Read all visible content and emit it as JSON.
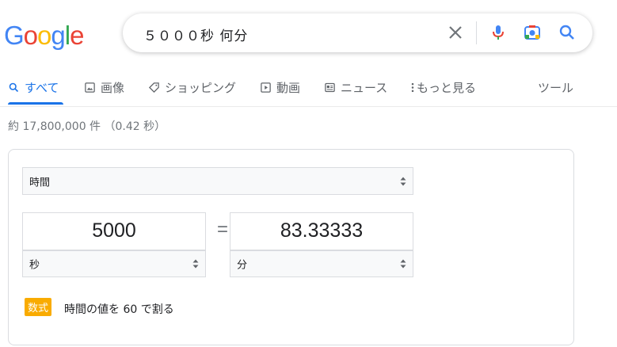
{
  "logo": {
    "letters": [
      "G",
      "o",
      "o",
      "g",
      "l",
      "e"
    ]
  },
  "search": {
    "query": "５０００秒 何分"
  },
  "tabs": [
    {
      "label": "すべて",
      "icon": "search-icon"
    },
    {
      "label": "画像",
      "icon": "image-icon"
    },
    {
      "label": "ショッピング",
      "icon": "tag-icon"
    },
    {
      "label": "動画",
      "icon": "play-icon"
    },
    {
      "label": "ニュース",
      "icon": "news-icon"
    },
    {
      "label": "もっと見る",
      "icon": "more-icon"
    },
    {
      "label": "ツール"
    }
  ],
  "result_stats": "約 17,800,000 件 （0.42 秒）",
  "converter": {
    "unit_type": "時間",
    "from_value": "5000",
    "from_unit": "秒",
    "equals": "=",
    "to_value": "83.33333",
    "to_unit": "分",
    "formula_badge": "数式",
    "formula_text": "時間の値を 60 で割る"
  },
  "colors": {
    "accent": "#1a73e8",
    "badge": "#f9ab00",
    "logo": [
      "#4285f4",
      "#ea4335",
      "#fbbc05",
      "#4285f4",
      "#34a853",
      "#ea4335"
    ]
  }
}
